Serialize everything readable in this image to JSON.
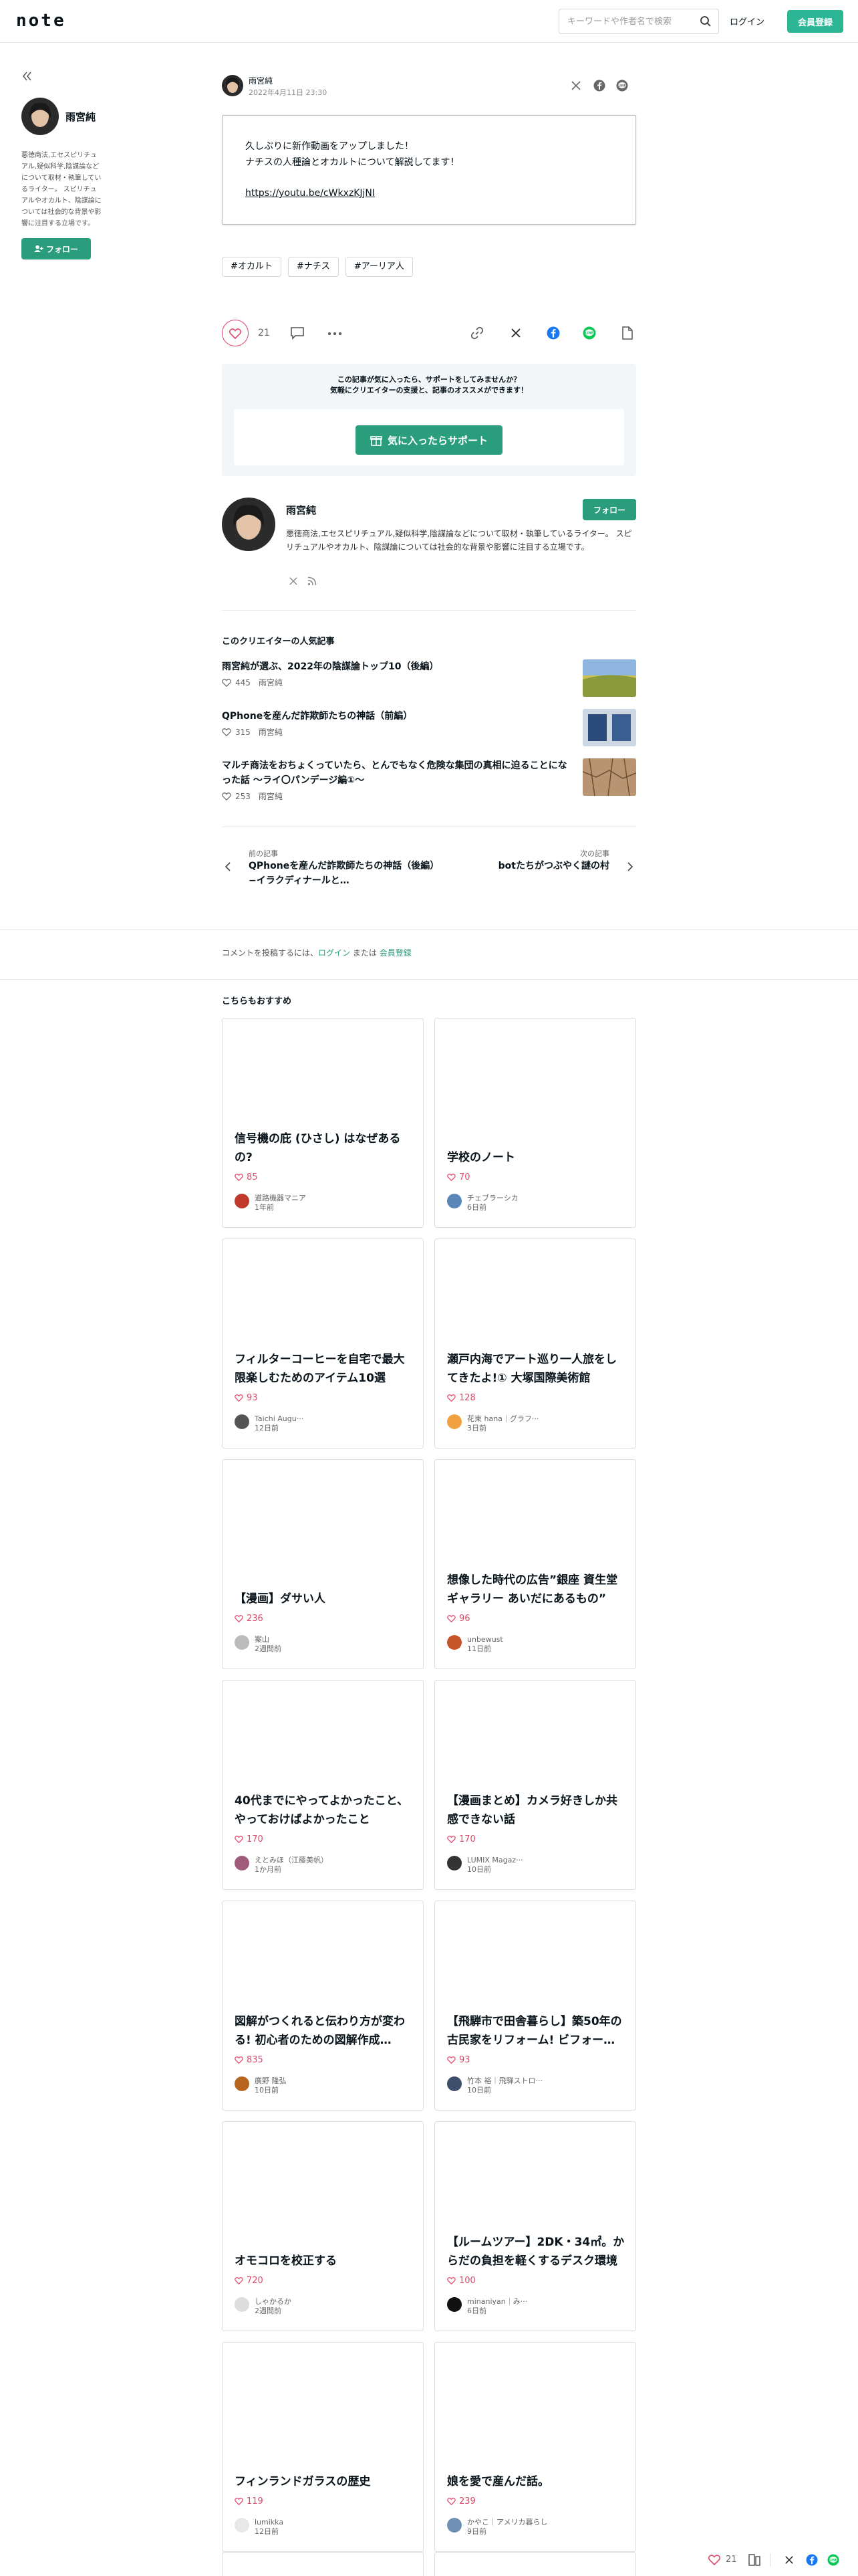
{
  "header": {
    "logo": "note",
    "search_placeholder": "キーワードや作者名で検索",
    "login_label": "ログイン",
    "signup_label": "会員登録"
  },
  "sidebar": {
    "creator_name": "雨宮純",
    "bio": "悪徳商法,エセスピリチュアル,疑似科学,陰謀論などについて取材・執筆しているライター。 スピリチュアルやオカルト、陰謀論については社会的な背景や影響に注目する立場です。",
    "follow_label": "フォロー"
  },
  "article": {
    "author": "雨宮純",
    "date": "2022年4月11日 23:30",
    "body_line1": "久しぶりに新作動画をアップしました！",
    "body_line2": "ナチスの人種論とオカルトについて解説してます！",
    "link": "https://youtu.be/cWkxzKJjNI",
    "tags": [
      "#オカルト",
      "#ナチス",
      "#アーリア人"
    ],
    "like_count": "21"
  },
  "support": {
    "line1": "この記事が気に入ったら、サポートをしてみませんか？",
    "line2": "気軽にクリエイターの支援と、記事のオススメができます！",
    "button_label": "気に入ったらサポート"
  },
  "author_box": {
    "name": "雨宮純",
    "follow_label": "フォロー",
    "bio": "悪徳商法,エセスピリチュアル,疑似科学,陰謀論などについて取材・執筆しているライター。 スピリチュアルやオカルト、陰謀論については社会的な背景や影響に注目する立場です。"
  },
  "popular": {
    "heading": "このクリエイターの人気記事",
    "items": [
      {
        "title": "雨宮純が選ぶ、2022年の陰謀論トップ10（後編）",
        "likes": "445",
        "author": "雨宮純"
      },
      {
        "title": "QPhoneを産んだ詐欺師たちの神話（前編）",
        "likes": "315",
        "author": "雨宮純"
      },
      {
        "title": "マルチ商法をおちょくっていたら、とんでもなく危険な集団の真相に迫ることになった話 〜ライ〇パンデージ編①〜",
        "likes": "253",
        "author": "雨宮純"
      }
    ]
  },
  "pager": {
    "prev_label": "前の記事",
    "prev_title": "QPhoneを産んだ詐欺師たちの神話（後編）−イラクディナールと…",
    "next_label": "次の記事",
    "next_title": "botたちがつぶやく謎の村"
  },
  "comment": {
    "prefix": "コメントを投稿するには、",
    "login": "ログイン",
    "or": "または",
    "signup": "会員登録"
  },
  "recommend": {
    "heading": "こちらもおすすめ",
    "cards": [
      {
        "title": "信号機の庇 (ひさし) はなぜあるの?",
        "likes": "85",
        "user": "道路機器マニア",
        "time": "1年前",
        "avatar": "#c0392b"
      },
      {
        "title": "学校のノート",
        "likes": "70",
        "user": "チェブラーシカ",
        "time": "6日前",
        "avatar": "#5a86b8"
      },
      {
        "title": "フィルターコーヒーを自宅で最大限楽しむためのアイテム10選",
        "likes": "93",
        "user": "Taichi Augu···",
        "time": "12日前",
        "avatar": "#555555"
      },
      {
        "title": "瀬戸内海でアート巡り一人旅をしてきたよ!① 大塚国際美術館",
        "likes": "128",
        "user": "花束 hana｜グラフ···",
        "time": "3日前",
        "avatar": "#f0a040"
      },
      {
        "title": "【漫画】ダサい人",
        "likes": "236",
        "user": "案山",
        "time": "2週間前",
        "avatar": "#bbbbbb"
      },
      {
        "title": "想像した時代の広告”銀座 資生堂ギャラリー あいだにあるもの”",
        "likes": "96",
        "user": "unbewust",
        "time": "11日前",
        "avatar": "#c8552a"
      },
      {
        "title": "40代までにやってよかったこと、やっておけばよかったこと",
        "likes": "170",
        "user": "えとみほ（江藤美帆）",
        "time": "1か月前",
        "avatar": "#a05a7a"
      },
      {
        "title": "【漫画まとめ】カメラ好きしか共感できない話",
        "likes": "170",
        "user": "LUMIX Magaz···",
        "time": "10日前",
        "avatar": "#333333"
      },
      {
        "title": "図解がつくれると伝わり方が変わる! 初心者のための図解作成…",
        "likes": "835",
        "user": "廣野 隆弘",
        "time": "10日前",
        "avatar": "#b5651d"
      },
      {
        "title": "【飛騨市で田舎暮らし】築50年の古民家をリフォーム! ビフォー…",
        "likes": "93",
        "user": "竹本 裕｜飛騨ストロ···",
        "time": "10日前",
        "avatar": "#3d4f6b"
      },
      {
        "title": "オモコロを校正する",
        "likes": "720",
        "user": "しゃかるか",
        "time": "2週間前",
        "avatar": "#dddddd"
      },
      {
        "title": "【ルームツアー】2DK・34㎡。からだの負担を軽くするデスク環境",
        "likes": "100",
        "user": "minaniyan｜み···",
        "time": "6日前",
        "avatar": "#111111"
      },
      {
        "title": "フィンランドガラスの歴史",
        "likes": "119",
        "user": "lumikka",
        "time": "12日前",
        "avatar": "#e8e8e8"
      },
      {
        "title": "娘を愛で産んだ話。",
        "likes": "239",
        "user": "かやこ｜アメリカ暮らし",
        "time": "9日前",
        "avatar": "#6f8fb5"
      }
    ]
  },
  "bottom_bar": {
    "like_count": "21"
  }
}
